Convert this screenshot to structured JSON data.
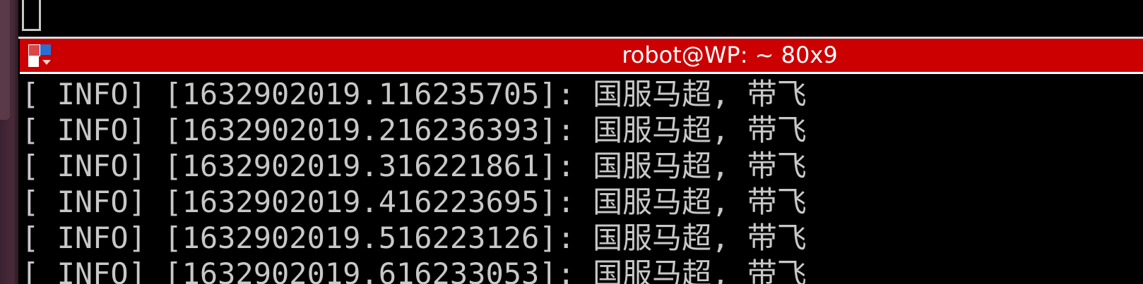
{
  "window": {
    "title": "robot@WP: ~ 80x9"
  },
  "log_lines": [
    "[ INFO] [1632902019.116235705]: 国服马超, 带飞",
    "[ INFO] [1632902019.216236393]: 国服马超, 带飞",
    "[ INFO] [1632902019.316221861]: 国服马超, 带飞",
    "[ INFO] [1632902019.416223695]: 国服马超, 带飞",
    "[ INFO] [1632902019.516223126]: 国服马超, 带飞",
    "[ INFO] [1632902019.616233053]: 国服马超, 带飞"
  ],
  "colors": {
    "titlebar": "#cc0000",
    "terminal_bg": "#000000",
    "terminal_fg": "#c8c8c8"
  }
}
